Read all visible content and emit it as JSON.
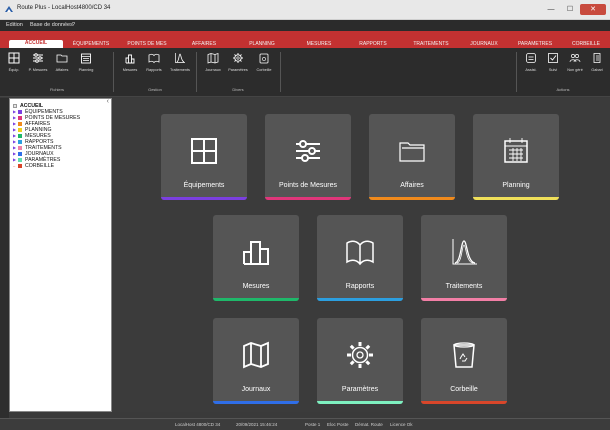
{
  "window": {
    "title": "Route Plus - LocalHost4800/CD 34",
    "minimize": "—",
    "maximize": "☐",
    "close": "✕"
  },
  "menu": [
    "Edition",
    "Base de données",
    "?"
  ],
  "tabs": [
    {
      "label": "ACCUEIL",
      "active": true
    },
    {
      "label": "ÉQUIPEMENTS"
    },
    {
      "label": "POINTS DE MES"
    },
    {
      "label": "AFFAIRES"
    },
    {
      "label": "PLANNING"
    },
    {
      "label": "MESURES"
    },
    {
      "label": "RAPPORTS"
    },
    {
      "label": "TRAITEMENTS"
    },
    {
      "label": "JOURNAUX"
    },
    {
      "label": "PARAMETRES"
    },
    {
      "label": "CORBEILLE"
    }
  ],
  "ribbon": {
    "buttons": [
      {
        "label": "Équip.",
        "icon": "grid-icon"
      },
      {
        "label": "P. Mesures",
        "icon": "sliders-icon"
      },
      {
        "label": "Affaires",
        "icon": "folder-icon"
      },
      {
        "label": "Planning",
        "icon": "calendar-icon"
      },
      {
        "label": "Mesures",
        "icon": "bars-icon"
      },
      {
        "label": "Rapports",
        "icon": "book-icon"
      },
      {
        "label": "Traitements",
        "icon": "curve-icon"
      },
      {
        "label": "Journaux",
        "icon": "map-icon"
      },
      {
        "label": "Paramètres",
        "icon": "gear-icon"
      },
      {
        "label": "Corbeille",
        "icon": "recycle-bin-icon"
      },
      {
        "label": "Assist.",
        "icon": "assistant-icon"
      },
      {
        "label": "Suivi",
        "icon": "check-icon"
      },
      {
        "label": "Non géré",
        "icon": "people-icon"
      },
      {
        "label": "Gabari",
        "icon": "template-icon"
      }
    ],
    "groups": [
      "Fichiers",
      "Gestion",
      "Divers",
      "Actions"
    ]
  },
  "tree": [
    {
      "label": "ACCUEIL",
      "color": "#e6e6e6",
      "bold": true
    },
    {
      "label": "ÉQUIPEMENTS",
      "color": "#7b3fe0"
    },
    {
      "label": "POINTS DE MESURES",
      "color": "#e0367a"
    },
    {
      "label": "AFFAIRES",
      "color": "#f08a1c"
    },
    {
      "label": "PLANNING",
      "color": "#f0d21c"
    },
    {
      "label": "MESURES",
      "color": "#1fb86a"
    },
    {
      "label": "RAPPORTS",
      "color": "#2c9fe0"
    },
    {
      "label": "TRAITEMENTS",
      "color": "#f27fa6"
    },
    {
      "label": "JOURNAUX",
      "color": "#2f6ee8"
    },
    {
      "label": "PARAMÈTRES",
      "color": "#5fe0b0"
    },
    {
      "label": "CORBEILLE",
      "color": "#d9462a"
    }
  ],
  "tiles": [
    {
      "label": "Équipements",
      "color": "#7b3fe0"
    },
    {
      "label": "Points de Mesures",
      "color": "#e0367a"
    },
    {
      "label": "Affaires",
      "color": "#f08a1c"
    },
    {
      "label": "Planning",
      "color": "#f0e05a"
    },
    {
      "label": "Mesures",
      "color": "#1fb86a"
    },
    {
      "label": "Rapports",
      "color": "#2c9fe0"
    },
    {
      "label": "Traitements",
      "color": "#f27fa6"
    },
    {
      "label": "Journaux",
      "color": "#2f6ee8"
    },
    {
      "label": "Paramètres",
      "color": "#7ef0c0"
    },
    {
      "label": "Corbeille",
      "color": "#d9462a"
    }
  ],
  "status": {
    "server": "LocalHost 4800/CD 34",
    "datetime": "20/09/2021 15:46:24",
    "poste": "Poste 1",
    "eloc": "Eloc Poste",
    "demat": "Démat. Route",
    "licence": "Licence Ok"
  }
}
